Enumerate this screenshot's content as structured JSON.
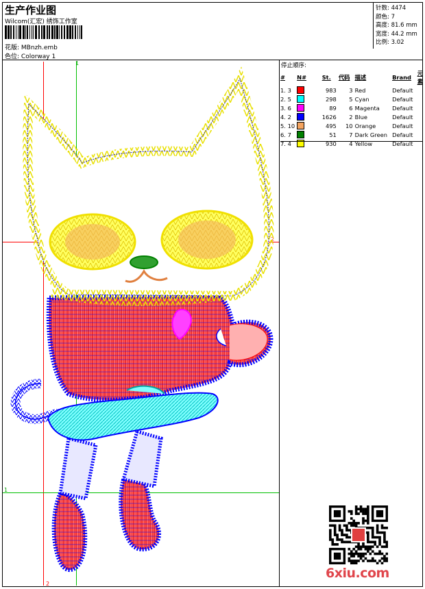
{
  "header": {
    "title": "生产作业图",
    "company": "Wilcom(汇宏) 绣饰工作室",
    "design_label": "花版:",
    "design_value": "MBnzh.emb",
    "colorway_label": "色位:",
    "colorway_value": "Colorway 1"
  },
  "stats": [
    {
      "label": "针数:",
      "value": "4474"
    },
    {
      "label": "颜色:",
      "value": "7"
    },
    {
      "label": "高度:",
      "value": "81.6 mm"
    },
    {
      "label": "宽度:",
      "value": "44.2 mm"
    },
    {
      "label": "比例:",
      "value": "3.02"
    }
  ],
  "stop_sequence": {
    "title": "停止顺序:",
    "headers": [
      "#",
      "N#",
      "St.",
      "代码",
      "描述",
      "Brand",
      "元素"
    ],
    "rows": [
      {
        "idx": "1.",
        "n": "3",
        "color": "#ff0000",
        "st": "983",
        "code": "3",
        "desc": "Red",
        "brand": "Default"
      },
      {
        "idx": "2.",
        "n": "5",
        "color": "#00ffff",
        "st": "298",
        "code": "5",
        "desc": "Cyan",
        "brand": "Default"
      },
      {
        "idx": "3.",
        "n": "6",
        "color": "#ff00ff",
        "st": "89",
        "code": "6",
        "desc": "Magenta",
        "brand": "Default"
      },
      {
        "idx": "4.",
        "n": "2",
        "color": "#0000ff",
        "st": "1626",
        "code": "2",
        "desc": "Blue",
        "brand": "Default"
      },
      {
        "idx": "5.",
        "n": "10",
        "color": "#f4a460",
        "st": "495",
        "code": "10",
        "desc": "Orange",
        "brand": "Default"
      },
      {
        "idx": "6.",
        "n": "7",
        "color": "#008000",
        "st": "51",
        "code": "7",
        "desc": "Dark Green",
        "brand": "Default"
      },
      {
        "idx": "7.",
        "n": "4",
        "color": "#ffff00",
        "st": "930",
        "code": "4",
        "desc": "Yellow",
        "brand": "Default"
      }
    ]
  },
  "guides": {
    "v1": "1",
    "h2": "2",
    "h1": "1",
    "v2": "2"
  },
  "watermark": "6xiu.com",
  "colors": {
    "guide": "#ff0000",
    "origin": "#00c000"
  }
}
